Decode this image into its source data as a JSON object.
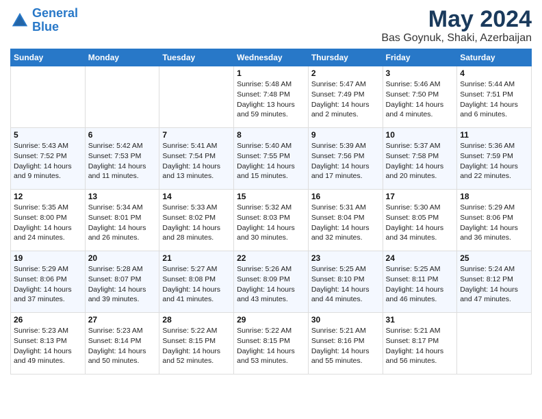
{
  "logo": {
    "line1": "General",
    "line2": "Blue"
  },
  "title": "May 2024",
  "subtitle": "Bas Goynuk, Shaki, Azerbaijan",
  "weekdays": [
    "Sunday",
    "Monday",
    "Tuesday",
    "Wednesday",
    "Thursday",
    "Friday",
    "Saturday"
  ],
  "weeks": [
    [
      {
        "day": "",
        "content": ""
      },
      {
        "day": "",
        "content": ""
      },
      {
        "day": "",
        "content": ""
      },
      {
        "day": "1",
        "content": "Sunrise: 5:48 AM\nSunset: 7:48 PM\nDaylight: 13 hours\nand 59 minutes."
      },
      {
        "day": "2",
        "content": "Sunrise: 5:47 AM\nSunset: 7:49 PM\nDaylight: 14 hours\nand 2 minutes."
      },
      {
        "day": "3",
        "content": "Sunrise: 5:46 AM\nSunset: 7:50 PM\nDaylight: 14 hours\nand 4 minutes."
      },
      {
        "day": "4",
        "content": "Sunrise: 5:44 AM\nSunset: 7:51 PM\nDaylight: 14 hours\nand 6 minutes."
      }
    ],
    [
      {
        "day": "5",
        "content": "Sunrise: 5:43 AM\nSunset: 7:52 PM\nDaylight: 14 hours\nand 9 minutes."
      },
      {
        "day": "6",
        "content": "Sunrise: 5:42 AM\nSunset: 7:53 PM\nDaylight: 14 hours\nand 11 minutes."
      },
      {
        "day": "7",
        "content": "Sunrise: 5:41 AM\nSunset: 7:54 PM\nDaylight: 14 hours\nand 13 minutes."
      },
      {
        "day": "8",
        "content": "Sunrise: 5:40 AM\nSunset: 7:55 PM\nDaylight: 14 hours\nand 15 minutes."
      },
      {
        "day": "9",
        "content": "Sunrise: 5:39 AM\nSunset: 7:56 PM\nDaylight: 14 hours\nand 17 minutes."
      },
      {
        "day": "10",
        "content": "Sunrise: 5:37 AM\nSunset: 7:58 PM\nDaylight: 14 hours\nand 20 minutes."
      },
      {
        "day": "11",
        "content": "Sunrise: 5:36 AM\nSunset: 7:59 PM\nDaylight: 14 hours\nand 22 minutes."
      }
    ],
    [
      {
        "day": "12",
        "content": "Sunrise: 5:35 AM\nSunset: 8:00 PM\nDaylight: 14 hours\nand 24 minutes."
      },
      {
        "day": "13",
        "content": "Sunrise: 5:34 AM\nSunset: 8:01 PM\nDaylight: 14 hours\nand 26 minutes."
      },
      {
        "day": "14",
        "content": "Sunrise: 5:33 AM\nSunset: 8:02 PM\nDaylight: 14 hours\nand 28 minutes."
      },
      {
        "day": "15",
        "content": "Sunrise: 5:32 AM\nSunset: 8:03 PM\nDaylight: 14 hours\nand 30 minutes."
      },
      {
        "day": "16",
        "content": "Sunrise: 5:31 AM\nSunset: 8:04 PM\nDaylight: 14 hours\nand 32 minutes."
      },
      {
        "day": "17",
        "content": "Sunrise: 5:30 AM\nSunset: 8:05 PM\nDaylight: 14 hours\nand 34 minutes."
      },
      {
        "day": "18",
        "content": "Sunrise: 5:29 AM\nSunset: 8:06 PM\nDaylight: 14 hours\nand 36 minutes."
      }
    ],
    [
      {
        "day": "19",
        "content": "Sunrise: 5:29 AM\nSunset: 8:06 PM\nDaylight: 14 hours\nand 37 minutes."
      },
      {
        "day": "20",
        "content": "Sunrise: 5:28 AM\nSunset: 8:07 PM\nDaylight: 14 hours\nand 39 minutes."
      },
      {
        "day": "21",
        "content": "Sunrise: 5:27 AM\nSunset: 8:08 PM\nDaylight: 14 hours\nand 41 minutes."
      },
      {
        "day": "22",
        "content": "Sunrise: 5:26 AM\nSunset: 8:09 PM\nDaylight: 14 hours\nand 43 minutes."
      },
      {
        "day": "23",
        "content": "Sunrise: 5:25 AM\nSunset: 8:10 PM\nDaylight: 14 hours\nand 44 minutes."
      },
      {
        "day": "24",
        "content": "Sunrise: 5:25 AM\nSunset: 8:11 PM\nDaylight: 14 hours\nand 46 minutes."
      },
      {
        "day": "25",
        "content": "Sunrise: 5:24 AM\nSunset: 8:12 PM\nDaylight: 14 hours\nand 47 minutes."
      }
    ],
    [
      {
        "day": "26",
        "content": "Sunrise: 5:23 AM\nSunset: 8:13 PM\nDaylight: 14 hours\nand 49 minutes."
      },
      {
        "day": "27",
        "content": "Sunrise: 5:23 AM\nSunset: 8:14 PM\nDaylight: 14 hours\nand 50 minutes."
      },
      {
        "day": "28",
        "content": "Sunrise: 5:22 AM\nSunset: 8:15 PM\nDaylight: 14 hours\nand 52 minutes."
      },
      {
        "day": "29",
        "content": "Sunrise: 5:22 AM\nSunset: 8:15 PM\nDaylight: 14 hours\nand 53 minutes."
      },
      {
        "day": "30",
        "content": "Sunrise: 5:21 AM\nSunset: 8:16 PM\nDaylight: 14 hours\nand 55 minutes."
      },
      {
        "day": "31",
        "content": "Sunrise: 5:21 AM\nSunset: 8:17 PM\nDaylight: 14 hours\nand 56 minutes."
      },
      {
        "day": "",
        "content": ""
      }
    ]
  ]
}
